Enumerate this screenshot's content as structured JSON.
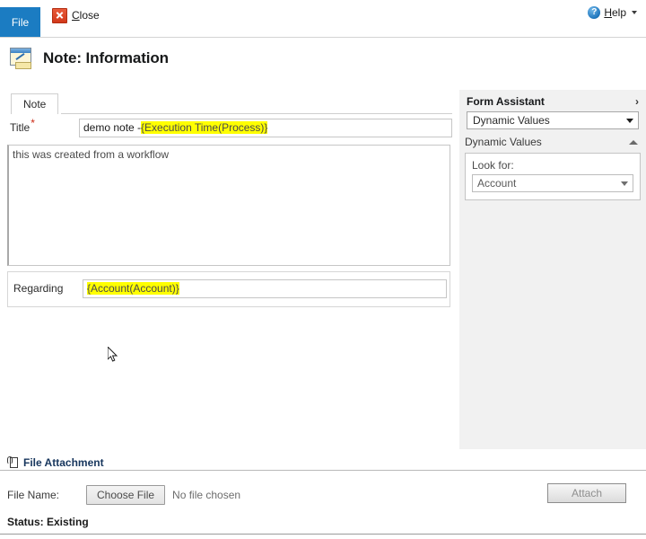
{
  "window": {
    "title": "Note: Information"
  },
  "ribbon": {
    "file_tab": "File",
    "close": {
      "label_prefix": "",
      "accesskey": "C",
      "label_rest": "lose",
      "icon": "close-x-icon"
    },
    "help": {
      "accesskey": "H",
      "label_rest": "elp",
      "icon": "help-question-icon"
    }
  },
  "header": {
    "icon": "note-record-icon",
    "title": "Note: Information"
  },
  "tabs": [
    {
      "label": "Note",
      "active": true
    }
  ],
  "form": {
    "title_field": {
      "label": "Title",
      "required_marker": "*",
      "value_plain": "demo note - ",
      "value_token": "{Execution Time(Process)}"
    },
    "note_body": {
      "value": "this was created from a workflow"
    },
    "regarding_field": {
      "label": "Regarding",
      "value_token": "{Account(Account)}"
    }
  },
  "assistant": {
    "title": "Form Assistant",
    "expand_icon": "›",
    "mode_select": {
      "value": "Dynamic Values",
      "caret": "chevron-down-icon"
    },
    "section": {
      "label": "Dynamic Values",
      "caret": "chevron-up-icon"
    },
    "look_for": {
      "label": "Look for:",
      "value": "Account",
      "caret": "chevron-down-icon"
    }
  },
  "attachment": {
    "section_title": "File Attachment",
    "section_icon": "paperclip-icon",
    "file_name_label": "File Name:",
    "choose_file_label": "Choose File",
    "no_file_text": "No file chosen",
    "attach_button_label": "Attach"
  },
  "status": {
    "text": "Status: Existing"
  },
  "colors": {
    "file_tab_blue": "#1b7cc2",
    "highlight_yellow": "#ffff00",
    "required_red": "#cc2a16",
    "attachment_header_blue": "#17365d",
    "assistant_panel_gray": "#f1f1f1"
  }
}
